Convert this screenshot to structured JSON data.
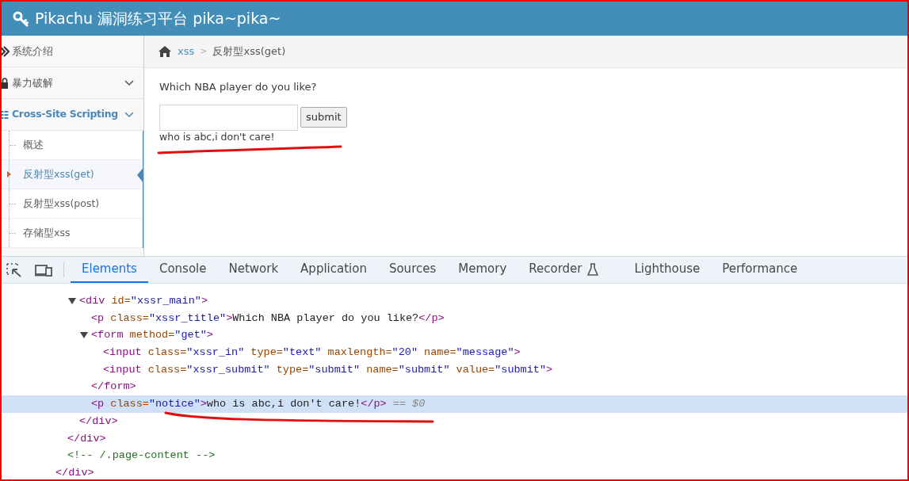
{
  "header": {
    "title": "Pikachu 漏洞练习平台 pika~pika~"
  },
  "sidebar": {
    "items": [
      {
        "label": "系统介绍"
      },
      {
        "label": "暴力破解",
        "expanded": false
      },
      {
        "label": "Cross-Site Scripting",
        "expanded": true,
        "children": [
          {
            "label": "概述",
            "selected": false
          },
          {
            "label": "反射型xss(get)",
            "selected": true
          },
          {
            "label": "反射型xss(post)",
            "selected": false
          },
          {
            "label": "存储型xss",
            "selected": false
          }
        ]
      }
    ]
  },
  "breadcrumb": [
    {
      "label": "xss",
      "kind": "link"
    },
    {
      "label": ">",
      "kind": "separator"
    },
    {
      "label": "反射型xss(get)",
      "kind": "current"
    }
  ],
  "form": {
    "question": "Which NBA player do you like?",
    "button": "submit",
    "notice": "who is abc,i don't care!"
  },
  "devtools": {
    "tabs": [
      {
        "label": "Elements",
        "selected": true
      },
      {
        "label": "Console",
        "selected": false
      },
      {
        "label": "Network",
        "selected": false
      },
      {
        "label": "Application",
        "selected": false
      },
      {
        "label": "Sources",
        "selected": false
      },
      {
        "label": "Memory",
        "selected": false
      },
      {
        "label": "Recorder",
        "selected": false
      },
      {
        "label": "Lighthouse",
        "selected": false
      },
      {
        "label": "Performance",
        "selected": false
      }
    ],
    "nodes": [
      {
        "children": [
          {
            "children": [
              {
                "tokens": [
                  {
                    "kind": "tag",
                    "text": "<div"
                  },
                  {
                    "kind": "attr",
                    "text": " id="
                  },
                  {
                    "kind": "value",
                    "text": "\"xssr_main\""
                  },
                  {
                    "kind": "tag",
                    "text": ">"
                  }
                ],
                "expanded": true,
                "selected": false,
                "children": [
                  {
                    "tokens": [
                      {
                        "kind": "tag",
                        "text": "<p"
                      },
                      {
                        "kind": "attr",
                        "text": " class="
                      },
                      {
                        "kind": "value",
                        "text": "\"xssr_title\""
                      },
                      {
                        "kind": "tag",
                        "text": ">"
                      },
                      {
                        "kind": "text",
                        "text": "Which NBA player do you like?"
                      },
                      {
                        "kind": "tag",
                        "text": "</p>"
                      }
                    ],
                    "selected": false
                  },
                  {
                    "tokens": [
                      {
                        "kind": "tag",
                        "text": "<form"
                      },
                      {
                        "kind": "attr",
                        "text": " method="
                      },
                      {
                        "kind": "value",
                        "text": "\"get\""
                      },
                      {
                        "kind": "tag",
                        "text": ">"
                      }
                    ],
                    "expanded": true,
                    "selected": false,
                    "children": [
                      {
                        "tokens": [
                          {
                            "kind": "tag",
                            "text": "<input"
                          },
                          {
                            "kind": "attr",
                            "text": " class="
                          },
                          {
                            "kind": "value",
                            "text": "\"xssr_in\""
                          },
                          {
                            "kind": "attr",
                            "text": " type="
                          },
                          {
                            "kind": "value",
                            "text": "\"text\""
                          },
                          {
                            "kind": "attr",
                            "text": " maxlength="
                          },
                          {
                            "kind": "value",
                            "text": "\"20\""
                          },
                          {
                            "kind": "attr",
                            "text": " name="
                          },
                          {
                            "kind": "value",
                            "text": "\"message\""
                          },
                          {
                            "kind": "tag",
                            "text": ">"
                          }
                        ],
                        "selected": false
                      },
                      {
                        "tokens": [
                          {
                            "kind": "tag",
                            "text": "<input"
                          },
                          {
                            "kind": "attr",
                            "text": " class="
                          },
                          {
                            "kind": "value",
                            "text": "\"xssr_submit\""
                          },
                          {
                            "kind": "attr",
                            "text": " type="
                          },
                          {
                            "kind": "value",
                            "text": "\"submit\""
                          },
                          {
                            "kind": "attr",
                            "text": " name="
                          },
                          {
                            "kind": "value",
                            "text": "\"submit\""
                          },
                          {
                            "kind": "attr",
                            "text": " value="
                          },
                          {
                            "kind": "value",
                            "text": "\"submit\""
                          },
                          {
                            "kind": "tag",
                            "text": ">"
                          }
                        ],
                        "selected": false
                      }
                    ],
                    "close": [
                      {
                        "kind": "tag",
                        "text": "</form>"
                      }
                    ]
                  },
                  {
                    "tokens": [
                      {
                        "kind": "tag",
                        "text": "<p"
                      },
                      {
                        "kind": "attr",
                        "text": " class="
                      },
                      {
                        "kind": "value",
                        "text": "\"notice\""
                      },
                      {
                        "kind": "tag",
                        "text": ">"
                      },
                      {
                        "kind": "text",
                        "text": "who is abc,i don't care!"
                      },
                      {
                        "kind": "tag",
                        "text": "</p>"
                      },
                      {
                        "kind": "hint",
                        "text": " == $0"
                      }
                    ],
                    "selected": true
                  }
                ],
                "close": [
                  {
                    "kind": "tag",
                    "text": "</div>"
                  }
                ]
              }
            ],
            "close": [
              {
                "kind": "tag",
                "text": "</div>"
              }
            ]
          },
          {
            "tokens": [
              {
                "kind": "comment",
                "text": "<!-- /.page-content -->"
              }
            ],
            "selected": false
          }
        ],
        "close": [
          {
            "kind": "tag",
            "text": "</div>"
          }
        ]
      }
    ]
  }
}
